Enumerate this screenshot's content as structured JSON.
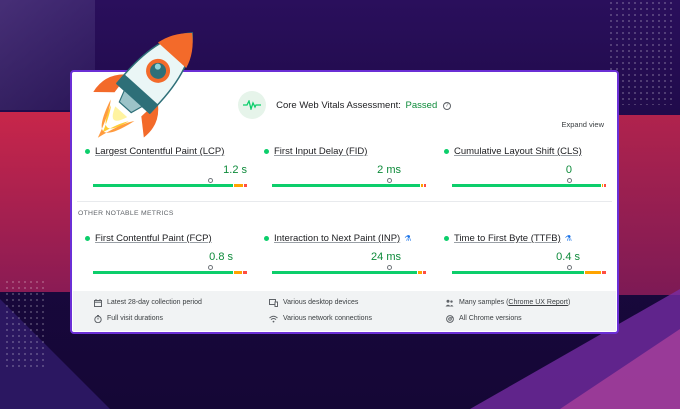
{
  "assessment": {
    "title": "Core Web Vitals Assessment:",
    "status": "Passed",
    "expand_label": "Expand view"
  },
  "core_metrics": [
    {
      "name": "Largest Contentful Paint (LCP)",
      "value": "1.2 s",
      "experimental": false
    },
    {
      "name": "First Input Delay (FID)",
      "value": "2 ms",
      "experimental": false
    },
    {
      "name": "Cumulative Layout Shift (CLS)",
      "value": "0",
      "experimental": false
    }
  ],
  "other_metrics_label": "OTHER NOTABLE METRICS",
  "other_metrics": [
    {
      "name": "First Contentful Paint (FCP)",
      "value": "0.8 s",
      "experimental": false
    },
    {
      "name": "Interaction to Next Paint (INP)",
      "value": "24 ms",
      "experimental": true
    },
    {
      "name": "Time to First Byte (TTFB)",
      "value": "0.4 s",
      "experimental": true
    }
  ],
  "footer": {
    "collection_period": "Latest 28-day collection period",
    "visit_durations": "Full visit durations",
    "devices": "Various desktop devices",
    "network": "Various network connections",
    "samples_prefix": "Many samples (",
    "samples_link": "Chrome UX Report",
    "samples_suffix": ")",
    "chrome_versions": "All Chrome versions"
  },
  "icons": {
    "vitals": "pulse-icon",
    "help": "help-circle-icon",
    "experimental": "flask-icon",
    "calendar": "calendar-icon",
    "timer": "timer-icon",
    "devices": "devices-icon",
    "wifi": "wifi-icon",
    "samples": "people-icon",
    "chrome": "chrome-icon"
  },
  "colors": {
    "good": "#0cce6b",
    "needs_improvement": "#ffa400",
    "poor": "#ff4e42",
    "passed_text": "#0d8a3a",
    "frame_border": "#6b2fd6"
  }
}
